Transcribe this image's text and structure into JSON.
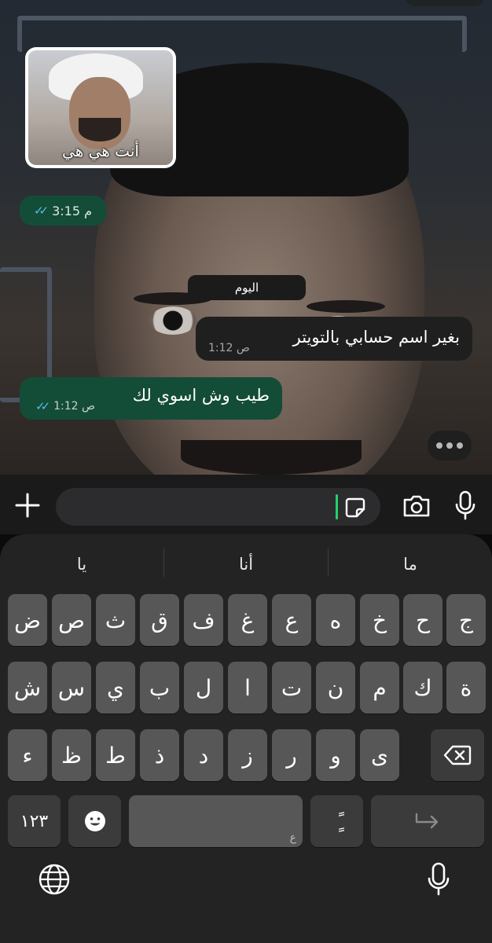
{
  "chat": {
    "sticker_caption": "أنت هي هي",
    "sticker_time": "3:15 م",
    "date_divider": "اليوم",
    "incoming": {
      "text": "بغير اسم حسابي بالتويتر",
      "time": "1:12 ص"
    },
    "outgoing": {
      "text": "طيب وش اسوي لك",
      "time": "1:12 ص"
    }
  },
  "input_bar": {
    "add_icon": "plus-icon",
    "sticker_icon": "sticker-icon",
    "camera_icon": "camera-icon",
    "mic_icon": "microphone-icon",
    "accent": "#25d366"
  },
  "keyboard": {
    "suggestions": [
      "ما",
      "أنا",
      "يا"
    ],
    "row1": [
      "ج",
      "ح",
      "خ",
      "ه",
      "ع",
      "غ",
      "ف",
      "ق",
      "ث",
      "ص",
      "ض"
    ],
    "row2": [
      "ة",
      "ك",
      "م",
      "ن",
      "ت",
      "ا",
      "ل",
      "ب",
      "ي",
      "س",
      "ش"
    ],
    "row3": [
      "ى",
      "و",
      "ر",
      "ز",
      "د",
      "ذ",
      "ط",
      "ظ",
      "ء"
    ],
    "numbers_key": "١٢٣",
    "emoji_icon": "emoji-icon",
    "space_hint": "ع",
    "diacritic_key": "ًٍ",
    "enter_icon": "return-icon",
    "backspace_icon": "backspace-icon",
    "globe_icon": "globe-icon",
    "dictation_icon": "microphone-icon"
  },
  "colors": {
    "outgoing_bubble": "#134d37",
    "incoming_bubble": "#1f1f1f",
    "read_ticks": "#53bdeb"
  }
}
